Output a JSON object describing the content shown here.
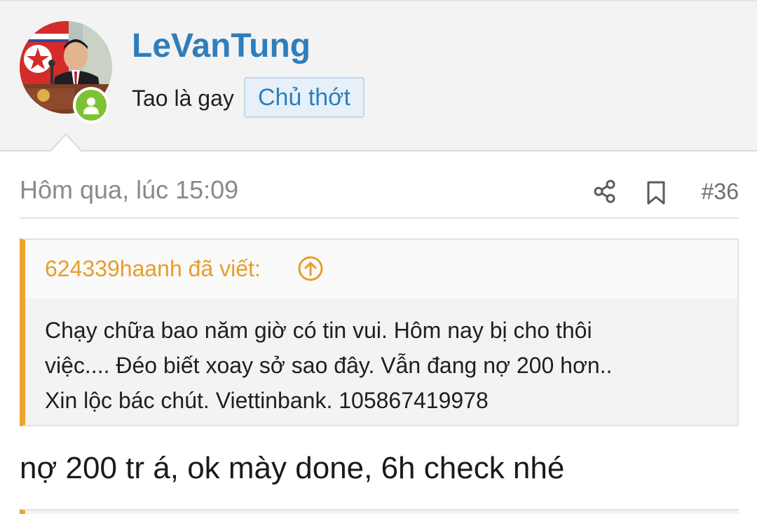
{
  "user": {
    "name": "LeVanTung",
    "title": "Tao là gay",
    "badge": "Chủ thớt",
    "online": true
  },
  "post": {
    "date": "Hôm qua, lúc 15:09",
    "number": "#36",
    "actions": [
      "share-icon",
      "bookmark-icon"
    ]
  },
  "quote": {
    "author": "624339haanh đã viết:",
    "lines": [
      "Chạy chữa bao năm giờ có tin vui. Hôm nay bị cho thôi",
      "việc.... Đéo biết xoay sở sao đây. Vẫn đang nợ 200 hơn..",
      "Xin lộc bác chút. Viettinbank. 105867419978"
    ]
  },
  "message": "nợ 200 tr á, ok mày done, 6h check nhé",
  "colors": {
    "username": "#2f7ebc",
    "quote_accent": "#f0a32a",
    "online": "#7cc232"
  }
}
